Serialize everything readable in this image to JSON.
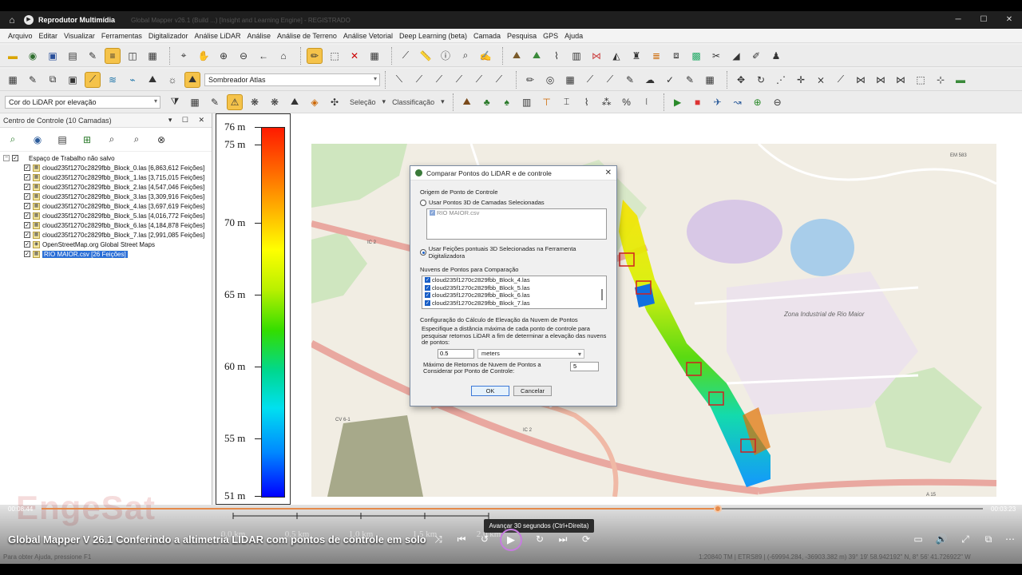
{
  "window": {
    "app_title": "Reprodutor Multimídia",
    "ghost_title": "Global Mapper v26.1 (Build ...) [Insight and Learning Engine] - REGISTRADO"
  },
  "menu": [
    "Arquivo",
    "Editar",
    "Visualizar",
    "Ferramentas",
    "Digitalizador",
    "Análise LiDAR",
    "Análise",
    "Análise de Terreno",
    "Análise Vetorial",
    "Deep Learning (beta)",
    "Camada",
    "Pesquisa",
    "GPS",
    "Ajuda"
  ],
  "toolbar": {
    "shader_select": "Sombreador Atlas",
    "lidar_color_select": "Cor do LiDAR por elevação",
    "selection_label": "Seleção",
    "classification_label": "Classificação"
  },
  "control_center": {
    "title": "Centro de Controle (10 Camadas)",
    "workspace": "Espaço de Trabalho não salvo",
    "layers": [
      "cloud235f1270c2829fbb_Block_0.las [6,863,612 Feições]",
      "cloud235f1270c2829fbb_Block_1.las [3,715,015 Feições]",
      "cloud235f1270c2829fbb_Block_2.las [4,547,046 Feições]",
      "cloud235f1270c2829fbb_Block_3.las [3,309,916 Feições]",
      "cloud235f1270c2829fbb_Block_4.las [3,697,619 Feições]",
      "cloud235f1270c2829fbb_Block_5.las [4,016,772 Feições]",
      "cloud235f1270c2829fbb_Block_6.las [4,184,878 Feições]",
      "cloud235f1270c2829fbb_Block_7.las [2,991,085 Feições]",
      "OpenStreetMap.org Global Street Maps"
    ],
    "selected_layer": "RIO MAIOR.csv [26 Feições]"
  },
  "legend": {
    "ticks": [
      "76 m",
      "75 m",
      "70 m",
      "65 m",
      "60 m",
      "55 m",
      "51 m"
    ]
  },
  "map_labels": {
    "zona": "Zona Industrial de Rio Maior",
    "roads": [
      "IC 2",
      "IC 2",
      "CV 6-1",
      "A 15",
      "EM 583"
    ]
  },
  "dialog": {
    "title": "Comparar Pontos do LiDAR e de controle",
    "origin_label": "Origem de Ponto de Controle",
    "radio1": "Usar Pontos 3D de Camadas Selecionadas",
    "radio1_item": "RIO MAIOR.csv",
    "radio2": "Usar Feições pontuais 3D Selecionadas na Ferramenta Digitalizadora",
    "clouds_label": "Nuvens de Pontos para Comparação",
    "clouds": [
      "cloud235f1270c2829fbb_Block_4.las",
      "cloud235f1270c2829fbb_Block_5.las",
      "cloud235f1270c2829fbb_Block_6.las",
      "cloud235f1270c2829fbb_Block_7.las"
    ],
    "config_label": "Configuração do Cálculo de Elevação da Nuvem de Pontos",
    "distance_desc": "Especifique a distância máxima de cada ponto de controle para pesquisar retornos LiDAR a fim de determinar a elevação das nuvens de pontos:",
    "distance_value": "0.5",
    "distance_unit": "meters",
    "max_returns_label": "Máximo de Retornos de Nuvem de Pontos a Considerar por Ponto de Controle:",
    "max_returns_value": "5",
    "ok": "OK",
    "cancel": "Cancelar"
  },
  "player": {
    "elapsed": "00:08:44",
    "duration": "00:03:23",
    "progress": 0.718,
    "video_title": "Global Mapper V 26.1 Conferindo a altimetria LIDAR com pontos de controle em solo",
    "tooltip": "Avançar 30 segundos (Ctrl+Direita)"
  },
  "scale": [
    "0.0 km",
    "0.5 km",
    "1.0 km",
    "1.5 km",
    "2.0 km"
  ],
  "status": {
    "left": "Para obter Ajuda, pressione F1",
    "right": "1:20840  TM | ETRS89 | (-69994.284, -36903.382 m) 39° 19' 58.942192\" N, 8° 56' 41.726922\" W"
  },
  "watermark": "EngeSat"
}
